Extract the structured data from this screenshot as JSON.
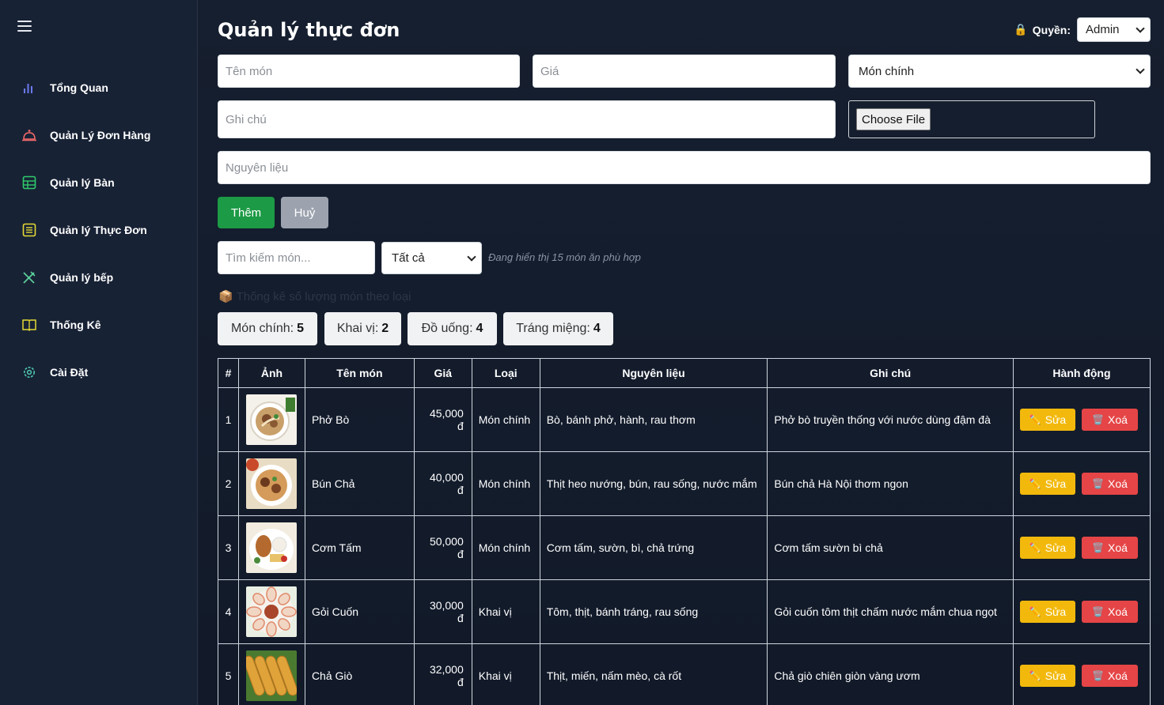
{
  "sidebar": {
    "items": [
      {
        "label": "Tổng Quan",
        "icon": "bar-chart-icon",
        "color": "#6b7bf2"
      },
      {
        "label": "Quản Lý Đơn Hàng",
        "icon": "bell-icon",
        "color": "#f36a6a"
      },
      {
        "label": "Quản lý Bàn",
        "icon": "table-grid-icon",
        "color": "#2fca6b"
      },
      {
        "label": "Quản lý Thực Đơn",
        "icon": "list-icon",
        "color": "#e4d935"
      },
      {
        "label": "Quản lý bếp",
        "icon": "utensils-icon",
        "color": "#5ad19c"
      },
      {
        "label": "Thống Kê",
        "icon": "book-icon",
        "color": "#e4d935"
      },
      {
        "label": "Cài Đặt",
        "icon": "gear-icon",
        "color": "#4ec9b0"
      }
    ]
  },
  "header": {
    "title": "Quản lý thực đơn",
    "role_label": "Quyền:",
    "role_value": "Admin"
  },
  "form": {
    "name_placeholder": "Tên món",
    "price_placeholder": "Giá",
    "category_value": "Món chính",
    "note_placeholder": "Ghi chú",
    "file_button": "Choose File",
    "ingredients_placeholder": "Nguyên liệu",
    "add_button": "Thêm",
    "cancel_button": "Huỷ"
  },
  "filter": {
    "search_placeholder": "Tìm kiếm món...",
    "category_value": "Tất cả",
    "hint": "Đang hiển thị 15 món ăn phù hợp"
  },
  "stats": {
    "title": "📦 Thống kê số lượng món theo loại",
    "chips": [
      {
        "label": "Món chính:",
        "count": "5"
      },
      {
        "label": "Khai vị:",
        "count": "2"
      },
      {
        "label": "Đồ uống:",
        "count": "4"
      },
      {
        "label": "Tráng miệng:",
        "count": "4"
      }
    ]
  },
  "table": {
    "headers": [
      "#",
      "Ảnh",
      "Tên món",
      "Giá",
      "Loại",
      "Nguyên liệu",
      "Ghi chú",
      "Hành động"
    ],
    "edit_label": "Sửa",
    "delete_label": "Xoá",
    "rows": [
      {
        "num": "1",
        "name": "Phở Bò",
        "price": "45,000 đ",
        "category": "Món chính",
        "ingredients": "Bò, bánh phở, hành, rau thơm",
        "note": "Phở bò truyền thống với nước dùng đậm đà"
      },
      {
        "num": "2",
        "name": "Bún Chả",
        "price": "40,000 đ",
        "category": "Món chính",
        "ingredients": "Thịt heo nướng, bún, rau sống, nước mắm",
        "note": "Bún chả Hà Nội thơm ngon"
      },
      {
        "num": "3",
        "name": "Cơm Tấm",
        "price": "50,000 đ",
        "category": "Món chính",
        "ingredients": "Cơm tấm, sườn, bì, chả trứng",
        "note": "Cơm tấm sườn bì chả"
      },
      {
        "num": "4",
        "name": "Gỏi Cuốn",
        "price": "30,000 đ",
        "category": "Khai vị",
        "ingredients": "Tôm, thịt, bánh tráng, rau sống",
        "note": "Gỏi cuốn tôm thịt chấm nước mắm chua ngọt"
      },
      {
        "num": "5",
        "name": "Chả Giò",
        "price": "32,000 đ",
        "category": "Khai vị",
        "ingredients": "Thịt, miến, nấm mèo, cà rốt",
        "note": "Chả giò chiên giòn vàng ươm"
      }
    ]
  }
}
